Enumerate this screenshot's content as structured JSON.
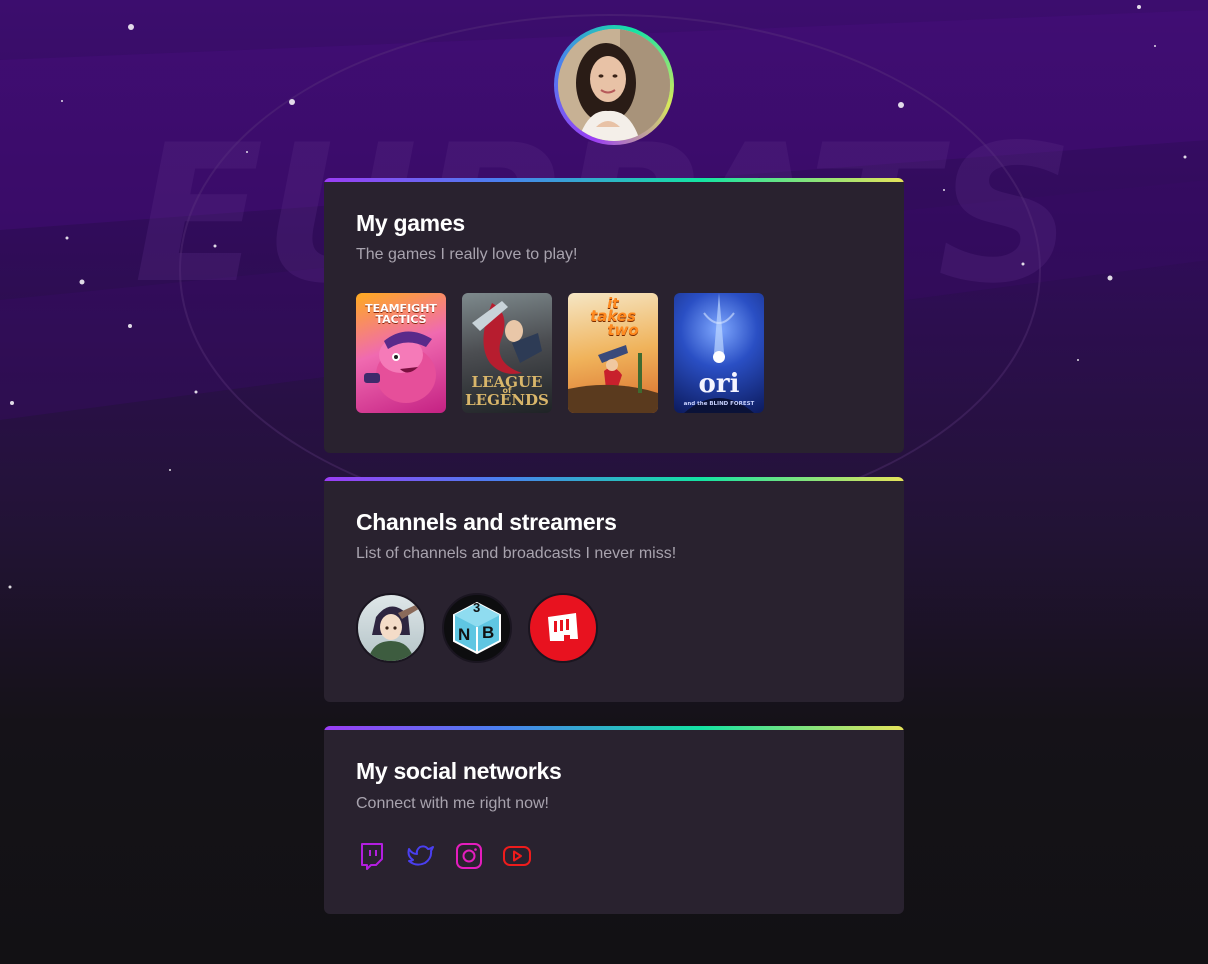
{
  "profile": {
    "avatar_icon": "user-avatar"
  },
  "background": {
    "logo_text": "EUPPATS"
  },
  "sections": {
    "games": {
      "title": "My games",
      "subtitle": "The games I really love to play!",
      "items": [
        {
          "title": "TEAMFIGHT TACTICS",
          "line1": "TEAMFIGHT",
          "line2": "TACTICS"
        },
        {
          "title": "LEAGUE OF LEGENDS",
          "line1": "LEAGUE",
          "line2": "LEGENDS",
          "mid": "of"
        },
        {
          "title": "It takes two",
          "line1": "it",
          "line2": "takes",
          "line3": "two"
        },
        {
          "title": "ori and the BLIND FOREST",
          "line1": "ori",
          "line2": "and the BLIND FOREST"
        }
      ]
    },
    "channels": {
      "title": "Channels and streamers",
      "subtitle": "List of channels and broadcasts I never miss!",
      "items": [
        {
          "icon": "anime-streamer-avatar"
        },
        {
          "icon": "nb-dice-logo",
          "label_top": "3",
          "label_left": "N",
          "label_right": "B"
        },
        {
          "icon": "riot-games-logo"
        }
      ]
    },
    "social": {
      "title": "My social networks",
      "subtitle": "Connect with me right now!",
      "items": [
        {
          "icon": "twitch-icon",
          "color": "#b31ee0"
        },
        {
          "icon": "twitter-icon",
          "color": "#4a3ff0"
        },
        {
          "icon": "instagram-icon",
          "color": "#e41dbd"
        },
        {
          "icon": "youtube-icon",
          "color": "#ee1c1c"
        }
      ]
    }
  },
  "colors": {
    "card_bg": "#29222f",
    "accent_gradient": [
      "#9b3df5",
      "#4b7ff0",
      "#14e3a3",
      "#e6e35a"
    ]
  }
}
